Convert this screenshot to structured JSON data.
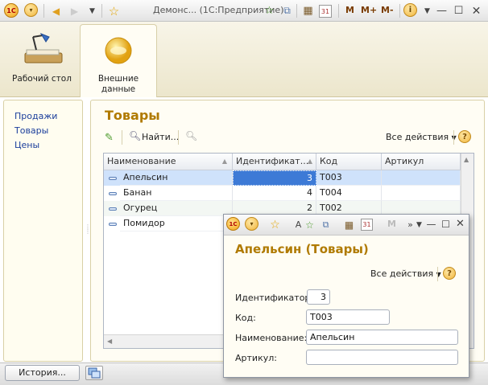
{
  "window": {
    "title": "Демонс... (1С:Предприятие)",
    "logo": "1С",
    "mem_buttons": [
      "M",
      "M+",
      "M-"
    ]
  },
  "sections": [
    {
      "label": "Рабочий стол",
      "icon": "desk-lamp-icon"
    },
    {
      "label": "Внешние данные",
      "icon": "external-data-icon"
    }
  ],
  "nav": {
    "items": [
      "Продажи",
      "Товары",
      "Цены"
    ]
  },
  "page": {
    "title": "Товары",
    "find_label": "Найти...",
    "all_actions": "Все действия",
    "help": "?"
  },
  "table": {
    "columns": [
      "Наименование",
      "Идентификат...",
      "Код",
      "Артикул"
    ],
    "rows": [
      {
        "name": "Апельсин",
        "id": "3",
        "code": "Т003",
        "article": ""
      },
      {
        "name": "Банан",
        "id": "4",
        "code": "Т004",
        "article": ""
      },
      {
        "name": "Огурец",
        "id": "2",
        "code": "Т002",
        "article": ""
      },
      {
        "name": "Помидор",
        "id": "",
        "code": "",
        "article": ""
      }
    ]
  },
  "bottom": {
    "history_label": "История..."
  },
  "popup": {
    "title": "Апельсин (Товары)",
    "all_actions": "Все действия",
    "help": "?",
    "fields": {
      "id_label": "Идентификатор:",
      "id_value": "3",
      "code_label": "Код:",
      "code_value": "Т003",
      "name_label": "Наименование:",
      "name_value": "Апельсин",
      "article_label": "Артикул:",
      "article_value": ""
    }
  },
  "colors": {
    "accent_title": "#b07a00",
    "selected_row": "#cfe2fb",
    "nav_link": "#1c3f9c"
  }
}
